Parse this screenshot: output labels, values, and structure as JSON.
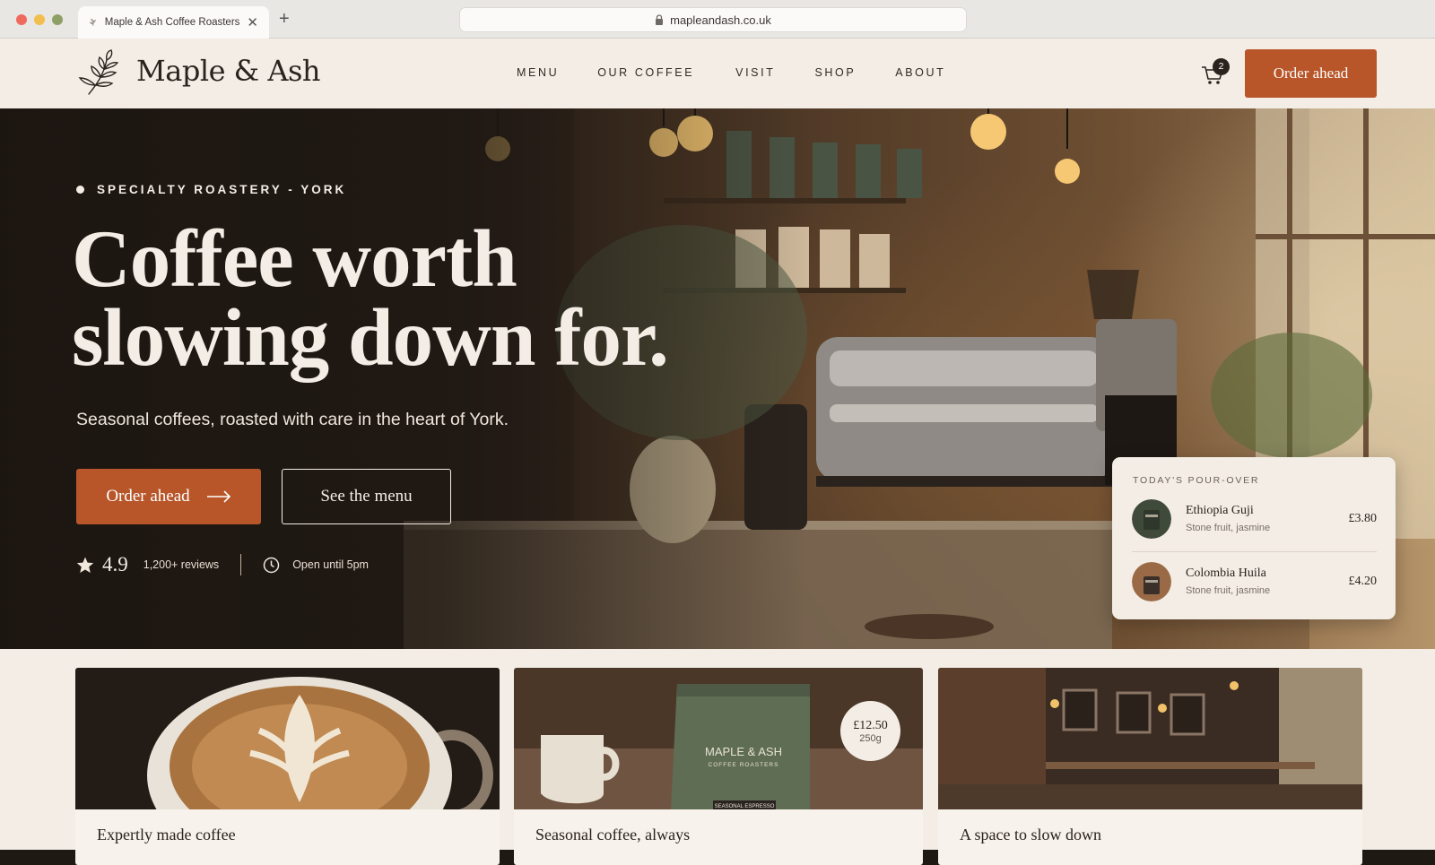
{
  "browser": {
    "tab_title": "Maple & Ash Coffee Roasters",
    "url": "mapleandash.co.uk"
  },
  "header": {
    "brand": "Maple & Ash",
    "nav": [
      "MENU",
      "OUR COFFEE",
      "VISIT",
      "SHOP",
      "ABOUT"
    ],
    "cart_count": "2",
    "cta": "Order ahead"
  },
  "hero": {
    "eyebrow": "SPECIALTY ROASTERY - YORK",
    "headline_line1": "Coffee worth",
    "headline_line2": "slowing down for.",
    "subhead": "Seasonal coffees, roasted with care in the heart of York.",
    "primary_button": "Order ahead",
    "secondary_button": "See the menu",
    "rating": "4.9",
    "reviews": "1,200+ reviews",
    "hours": "Open until 5pm"
  },
  "pour_over": {
    "title": "TODAY'S POUR-OVER",
    "items": [
      {
        "name": "Ethiopia Guji",
        "notes": "Stone fruit, jasmine",
        "price": "£3.80"
      },
      {
        "name": "Colombia Huila",
        "notes": "Stone fruit, jasmine",
        "price": "£4.20"
      }
    ]
  },
  "features": [
    {
      "title": "Expertly made coffee"
    },
    {
      "title": "Seasonal coffee, always",
      "price": "£12.50",
      "weight": "250g",
      "bag_brand": "MAPLE & ASH",
      "bag_sub": "COFFEE ROASTERS",
      "bag_label": "SEASONAL ESPRESSO"
    },
    {
      "title": "A space to slow down"
    }
  ],
  "colors": {
    "accent": "#b8562a",
    "cream": "#f3ede5",
    "dark": "#2a231d"
  }
}
